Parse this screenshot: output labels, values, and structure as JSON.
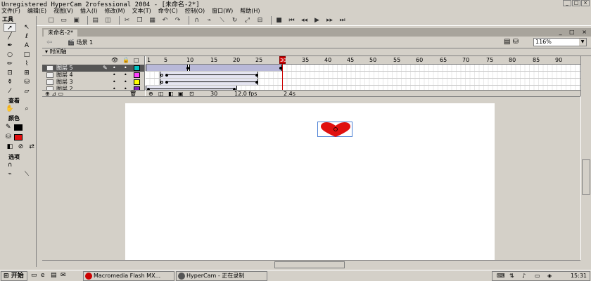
{
  "window": {
    "title": "Unregistered HyperCam 2rofessional 2004 - [未命名-2*]"
  },
  "menu": [
    "文件(F)",
    "编辑(E)",
    "视图(V)",
    "插入(I)",
    "修改(M)",
    "文本(T)",
    "命令(C)",
    "控制(O)",
    "窗口(W)",
    "帮助(H)"
  ],
  "tools": {
    "header": "工具",
    "view_label": "查看",
    "colors_label": "颜色",
    "options_label": "选项"
  },
  "document": {
    "tab": "未命名-2*",
    "scene": "场景 1",
    "zoom": "116%",
    "timeline_label": "时间轴"
  },
  "timeline": {
    "frame_numbers": [
      "1",
      "5",
      "10",
      "15",
      "20",
      "25",
      "30",
      "35",
      "40",
      "45",
      "50",
      "55",
      "60",
      "65",
      "70",
      "75",
      "80",
      "85",
      "90"
    ],
    "layers": [
      {
        "name": "图层 5",
        "color": "#00c0c0",
        "selected": true
      },
      {
        "name": "图层 4",
        "color": "#ff40ff",
        "selected": false
      },
      {
        "name": "图层 3",
        "color": "#ffff00",
        "selected": false
      },
      {
        "name": "图层 2",
        "color": "#8020c0",
        "selected": false
      }
    ],
    "current_frame": "30",
    "fps": "12.0 fps",
    "elapsed": "2.4s",
    "playhead_label": "30"
  },
  "stage": {
    "shape": "heart",
    "shape_color": "#e01010"
  },
  "taskbar": {
    "start": "开始",
    "tasks": [
      "Macromedia Flash MX...",
      "HyperCam - 正在录制"
    ],
    "clock": "15:31"
  },
  "colors": {
    "accent": "#c00000",
    "stage_bg": "#ffffff",
    "chrome": "#d4d0c8"
  }
}
